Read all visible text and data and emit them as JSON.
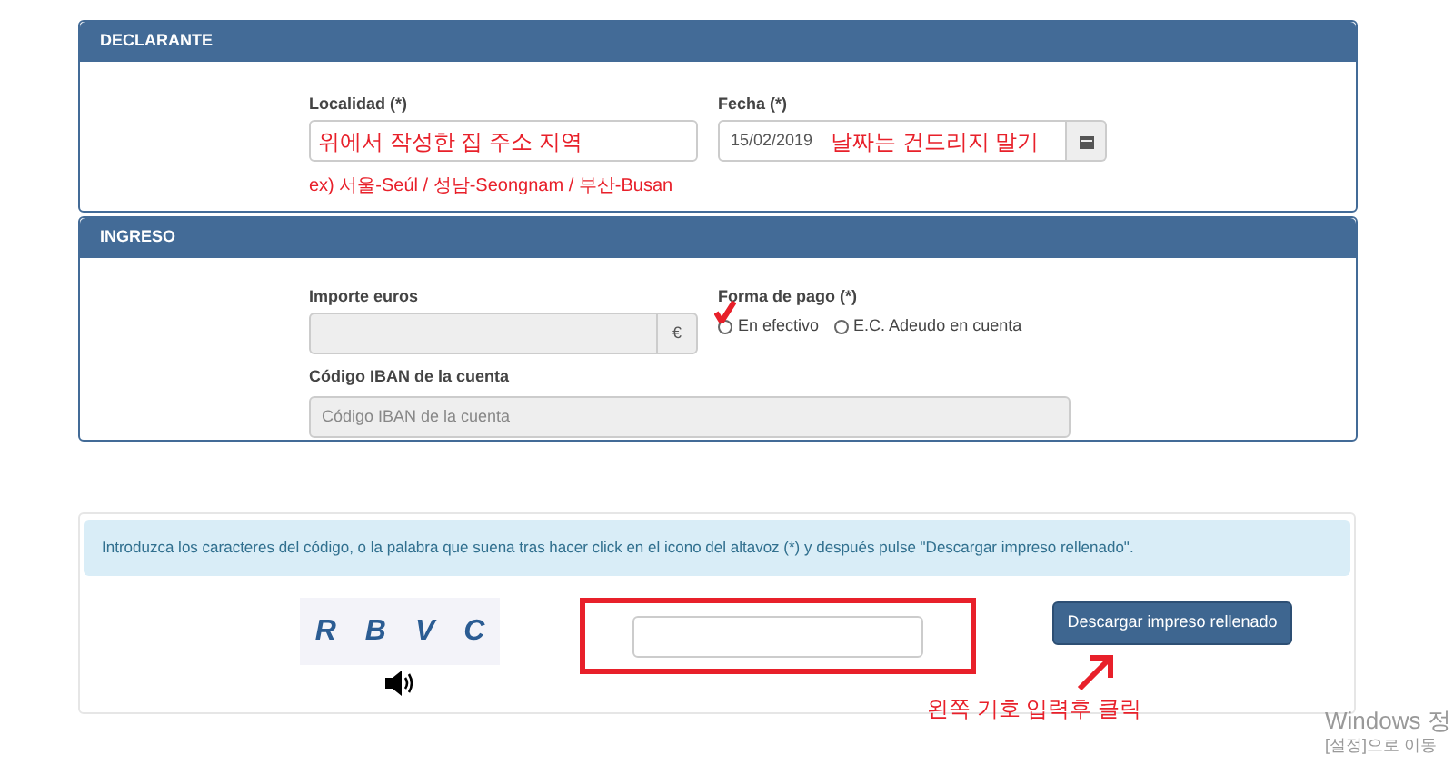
{
  "declarante": {
    "title": "DECLARANTE",
    "localidad": {
      "label": "Localidad (*)",
      "annotation": "위에서 작성한 집 주소 지역"
    },
    "example_note": "ex) 서울-Seúl / 성남-Seongnam / 부산-Busan",
    "fecha": {
      "label": "Fecha (*)",
      "value": "15/02/2019",
      "annotation": "날짜는 건드리지 말기"
    }
  },
  "ingreso": {
    "title": "INGRESO",
    "importe": {
      "label": "Importe euros",
      "addon": "€"
    },
    "forma_pago": {
      "label": "Forma de pago (*)",
      "options": [
        {
          "label": "En efectivo",
          "selected": false
        },
        {
          "label": "E.C. Adeudo en cuenta",
          "selected": false
        }
      ]
    },
    "iban": {
      "label": "Código IBAN de la cuenta",
      "placeholder": "Código IBAN de la cuenta"
    }
  },
  "captcha": {
    "info": "Introduzca los caracteres del código, o la palabra que suena tras hacer click en el icono del altavoz (*) y después pulse \"Descargar impreso rellenado\".",
    "characters": [
      "R",
      "B",
      "V",
      "C"
    ],
    "button": "Descargar impreso rellenado",
    "annotation": "왼쪽 기호 입력후 클릭"
  },
  "os_notice": [
    "Windows 정",
    "[설정]으로 이동"
  ]
}
